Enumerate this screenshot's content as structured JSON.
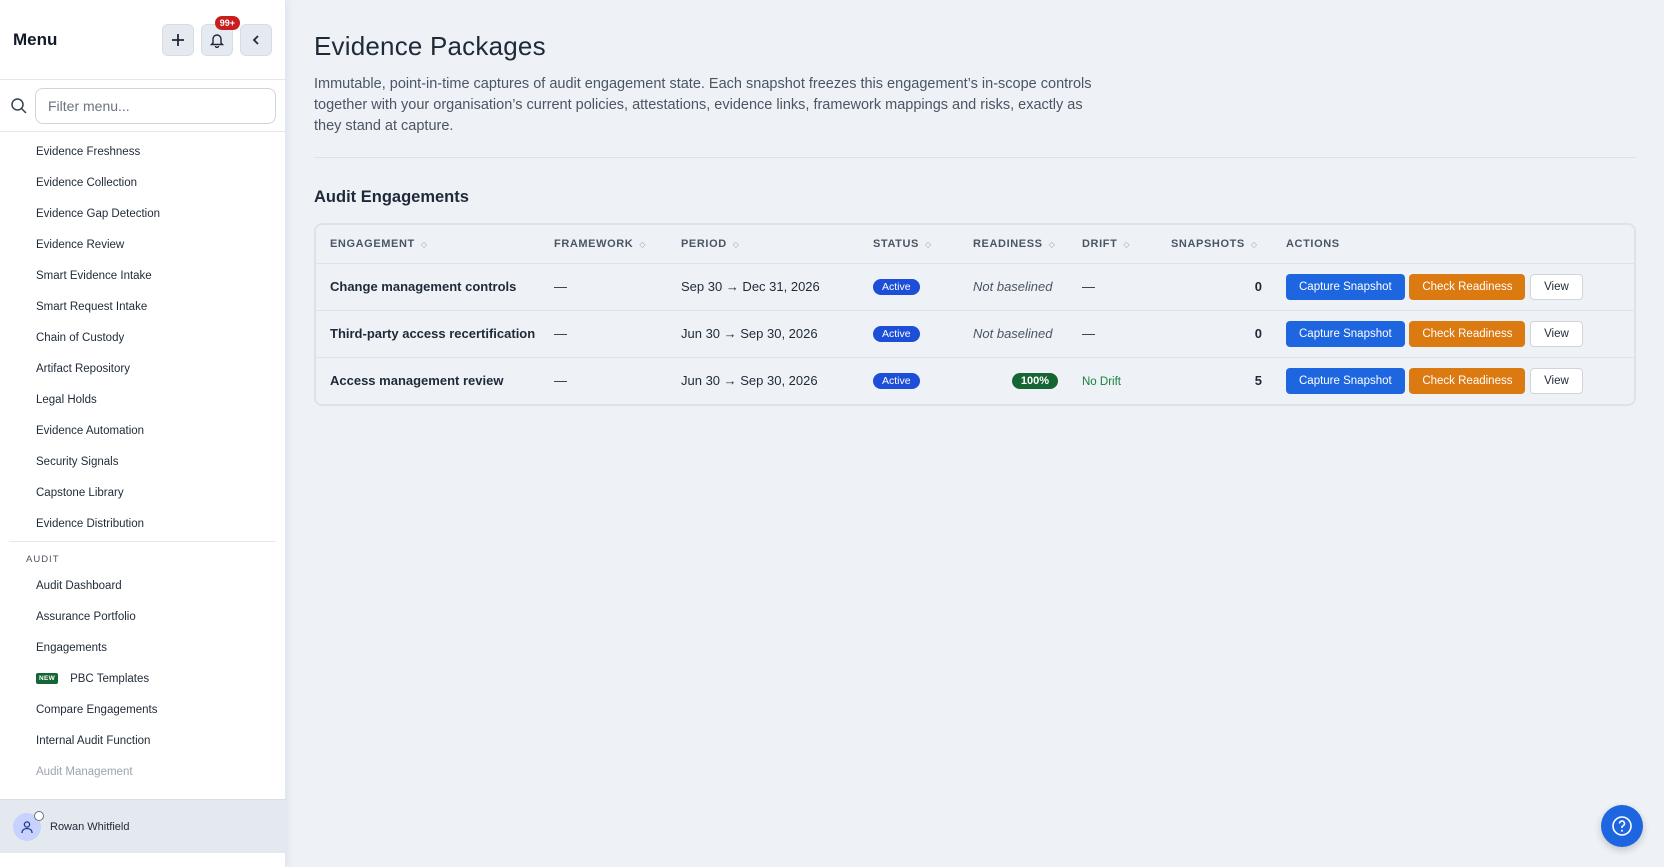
{
  "sidebar": {
    "title": "Menu",
    "notification_badge": "99+",
    "search_placeholder": "Filter menu...",
    "items": [
      {
        "label": "Evidence Freshness"
      },
      {
        "label": "Evidence Collection"
      },
      {
        "label": "Evidence Gap Detection"
      },
      {
        "label": "Evidence Review"
      },
      {
        "label": "Smart Evidence Intake"
      },
      {
        "label": "Smart Request Intake"
      },
      {
        "label": "Chain of Custody"
      },
      {
        "label": "Artifact Repository"
      },
      {
        "label": "Legal Holds"
      },
      {
        "label": "Evidence Automation"
      },
      {
        "label": "Security Signals"
      },
      {
        "label": "Capstone Library"
      },
      {
        "label": "Evidence Distribution"
      }
    ],
    "audit_section": {
      "label": "AUDIT",
      "items": [
        {
          "label": "Audit Dashboard"
        },
        {
          "label": "Assurance Portfolio"
        },
        {
          "label": "Engagements"
        },
        {
          "label": "PBC Templates",
          "badge": "NEW"
        },
        {
          "label": "Compare Engagements"
        },
        {
          "label": "Internal Audit Function"
        },
        {
          "label": "Audit Management"
        }
      ]
    },
    "user": {
      "name": "Rowan Whitfield"
    }
  },
  "main": {
    "title": "Evidence Packages",
    "description": "Immutable, point-in-time captures of audit engagement state. Each snapshot freezes this engagement’s in-scope controls together with your organisation’s current policies, attestations, evidence links, framework mappings and risks, exactly as they stand at capture.",
    "section_title": "Audit Engagements",
    "table": {
      "columns": [
        "ENGAGEMENT",
        "FRAMEWORK",
        "PERIOD",
        "STATUS",
        "READINESS",
        "DRIFT",
        "SNAPSHOTS",
        "ACTIONS"
      ],
      "rows": [
        {
          "engagement": "Change management controls",
          "framework": "—",
          "period": "Sep 30 → Dec 31, 2026",
          "status": "Active",
          "readiness": "Not baselined",
          "drift": "—",
          "snapshots": "0"
        },
        {
          "engagement": "Third-party access recertification",
          "framework": "—",
          "period": "Jun 30 → Sep 30, 2026",
          "status": "Active",
          "readiness": "Not baselined",
          "drift": "—",
          "snapshots": "0"
        },
        {
          "engagement": "Access management review",
          "framework": "—",
          "period": "Jun 30 → Sep 30, 2026",
          "status": "Active",
          "readiness": "100%",
          "drift": "No Drift",
          "snapshots": "5"
        }
      ],
      "actions": {
        "capture": "Capture Snapshot",
        "check": "Check Readiness",
        "view": "View"
      }
    }
  },
  "colors": {
    "primary": "#1d66e0",
    "warning": "#dc7a12",
    "success": "#166534",
    "badge_red": "#c81e1e"
  }
}
